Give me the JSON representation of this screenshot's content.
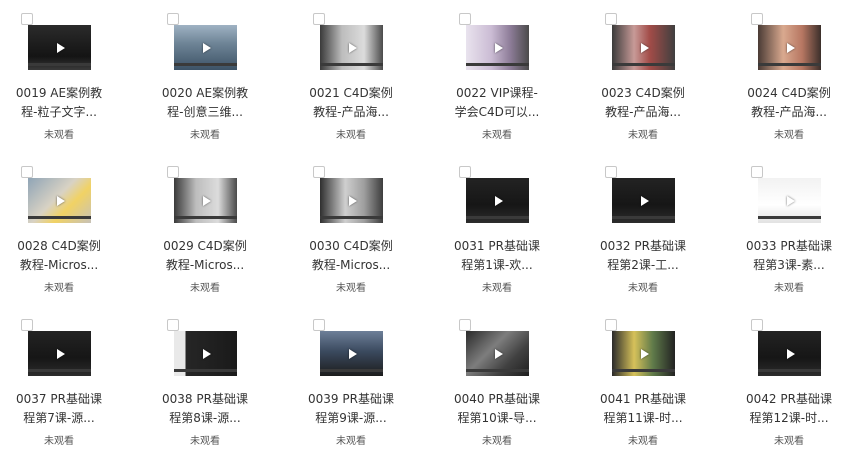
{
  "items": [
    {
      "line1": "0019 AE案例教",
      "line2": "程-粒子文字...",
      "status": "未观看",
      "theme": "dark-ui"
    },
    {
      "line1": "0020 AE案例教",
      "line2": "程-创意三维...",
      "status": "未观看",
      "theme": "aerial"
    },
    {
      "line1": "0021 C4D案例",
      "line2": "教程-产品海...",
      "status": "未观看",
      "theme": "c4d-grey"
    },
    {
      "line1": "0022 VIP课程-",
      "line2": "学会C4D可以...",
      "status": "未观看",
      "theme": "c4d-pink"
    },
    {
      "line1": "0023 C4D案例",
      "line2": "教程-产品海...",
      "status": "未观看",
      "theme": "c4d-red"
    },
    {
      "line1": "0024 C4D案例",
      "line2": "教程-产品海...",
      "status": "未观看",
      "theme": "c4d-warm"
    },
    {
      "line1": "0028 C4D案例",
      "line2": "教程-Micros...",
      "status": "未观看",
      "theme": "room"
    },
    {
      "line1": "0029 C4D案例",
      "line2": "教程-Micros...",
      "status": "未观看",
      "theme": "c4d-grey"
    },
    {
      "line1": "0030 C4D案例",
      "line2": "教程-Micros...",
      "status": "未观看",
      "theme": "c4d-grey2"
    },
    {
      "line1": "0031 PR基础课",
      "line2": "程第1课-欢...",
      "status": "未观看",
      "theme": "pr-dark"
    },
    {
      "line1": "0032 PR基础课",
      "line2": "程第2课-工...",
      "status": "未观看",
      "theme": "pr-dark"
    },
    {
      "line1": "0033 PR基础课",
      "line2": "程第3课-素...",
      "status": "未观看",
      "theme": "pr-white"
    },
    {
      "line1": "0037 PR基础课",
      "line2": "程第7课-源...",
      "status": "未观看",
      "theme": "pr-dark"
    },
    {
      "line1": "0038 PR基础课",
      "line2": "程第8课-源...",
      "status": "未观看",
      "theme": "pr-sidebar"
    },
    {
      "line1": "0039 PR基础课",
      "line2": "程第9课-源...",
      "status": "未观看",
      "theme": "pr-city"
    },
    {
      "line1": "0040 PR基础课",
      "line2": "程第10课-导...",
      "status": "未观看",
      "theme": "pr-grey"
    },
    {
      "line1": "0041 PR基础课",
      "line2": "程第11课-时...",
      "status": "未观看",
      "theme": "pr-yellow"
    },
    {
      "line1": "0042 PR基础课",
      "line2": "程第12课-时...",
      "status": "未观看",
      "theme": "pr-dark"
    }
  ],
  "colors": {
    "text": "#333333",
    "status": "#555555",
    "checkbox_border": "#c8c8c8"
  },
  "icons": {
    "play": "play-icon",
    "checkbox": "checkbox-icon"
  }
}
